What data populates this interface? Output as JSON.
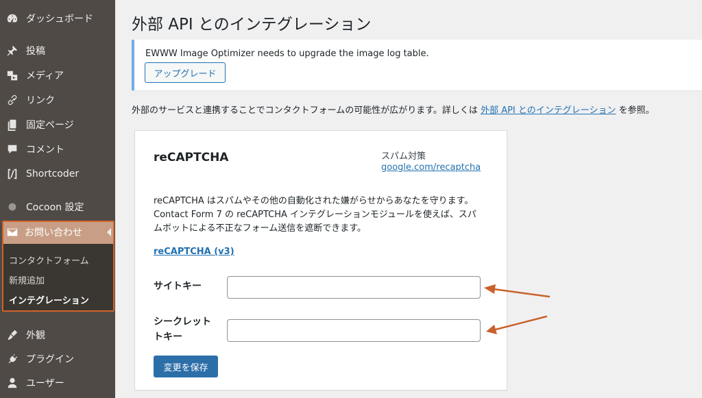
{
  "sidebar": {
    "items": [
      {
        "label": "ダッシュボード",
        "icon": "dashboard-icon"
      },
      {
        "label": "投稿",
        "icon": "pin-icon"
      },
      {
        "label": "メディア",
        "icon": "media-icon"
      },
      {
        "label": "リンク",
        "icon": "link-icon"
      },
      {
        "label": "固定ページ",
        "icon": "page-icon"
      },
      {
        "label": "コメント",
        "icon": "comment-icon"
      },
      {
        "label": "Shortcoder",
        "icon": "shortcode-icon"
      },
      {
        "label": "Cocoon 設定",
        "icon": "cocoon-icon"
      },
      {
        "label": "お問い合わせ",
        "icon": "mail-icon"
      },
      {
        "label": "外観",
        "icon": "appearance-icon"
      },
      {
        "label": "プラグイン",
        "icon": "plugin-icon"
      },
      {
        "label": "ユーザー",
        "icon": "user-icon"
      }
    ],
    "submenu": [
      "コンタクトフォーム",
      "新規追加",
      "インテグレーション"
    ]
  },
  "page": {
    "title": "外部 API とのインテグレーション",
    "notice_text": "EWWW Image Optimizer needs to upgrade the image log table.",
    "upgrade_label": "アップグレード",
    "intro_before": "外部のサービスと連携することでコンタクトフォームの可能性が広がります。詳しくは ",
    "intro_link": "外部 API とのインテグレーション",
    "intro_after": " を参照。"
  },
  "card": {
    "title": "reCAPTCHA",
    "category": "スパム対策",
    "link": "google.com/recaptcha",
    "desc": "reCAPTCHA はスパムやその他の自動化された嫌がらせからあなたを守ります。Contact Form 7 の reCAPTCHA インテグレーションモジュールを使えば、スパムボットによる不正なフォーム送信を遮断できます。",
    "v3_link": "reCAPTCHA (v3)",
    "site_key_label": "サイトキー",
    "secret_key_label_1": "シークレット",
    "secret_key_label_2": "トキー",
    "site_key_value": "",
    "secret_key_value": "",
    "save_label": "変更を保存"
  },
  "colors": {
    "accent": "#2271b1",
    "highlight": "#d2632a",
    "sidebar": "#4f4a45"
  }
}
